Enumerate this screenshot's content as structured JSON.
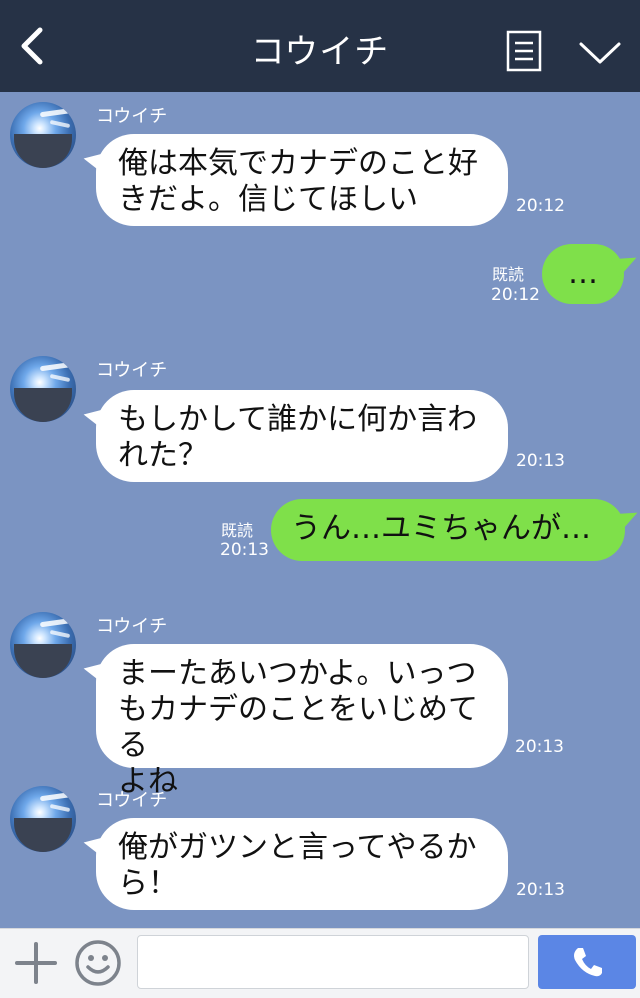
{
  "header": {
    "title": "コウイチ",
    "back_icon": "chevron-left-icon",
    "menu_icon": "menu-list-icon",
    "collapse_icon": "chevron-down-icon"
  },
  "messages": [
    {
      "sender": "コウイチ",
      "line1": "俺は本気でカナデのこと好",
      "line2": "きだよ。信じてほしい",
      "time": "20:12"
    },
    {
      "read": "既読",
      "time": "20:12",
      "text": "…"
    },
    {
      "sender": "コウイチ",
      "line1": "もしかして誰かに何か言わ",
      "line2": "れた？",
      "time": "20:13"
    },
    {
      "read": "既読",
      "time": "20:13",
      "text": "うん…ユミちゃんが…"
    },
    {
      "sender": "コウイチ",
      "line1": "まーたあいつかよ。いっつ",
      "line2": "もカナデのことをいじめてる",
      "line3": "よね",
      "time": "20:13"
    },
    {
      "sender": "コウイチ",
      "line1": "俺がガツンと言ってやるか",
      "line2": "ら！",
      "time": "20:13"
    }
  ],
  "input_bar": {
    "plus_icon": "plus-icon",
    "emoji_icon": "smiley-icon",
    "message_value": "",
    "call_icon": "phone-icon"
  },
  "colors": {
    "header_bg": "#263246",
    "chat_bg": "#7b94c2",
    "sent_bubble": "#7fe04a",
    "received_bubble": "#ffffff",
    "call_button": "#5b86e5"
  }
}
